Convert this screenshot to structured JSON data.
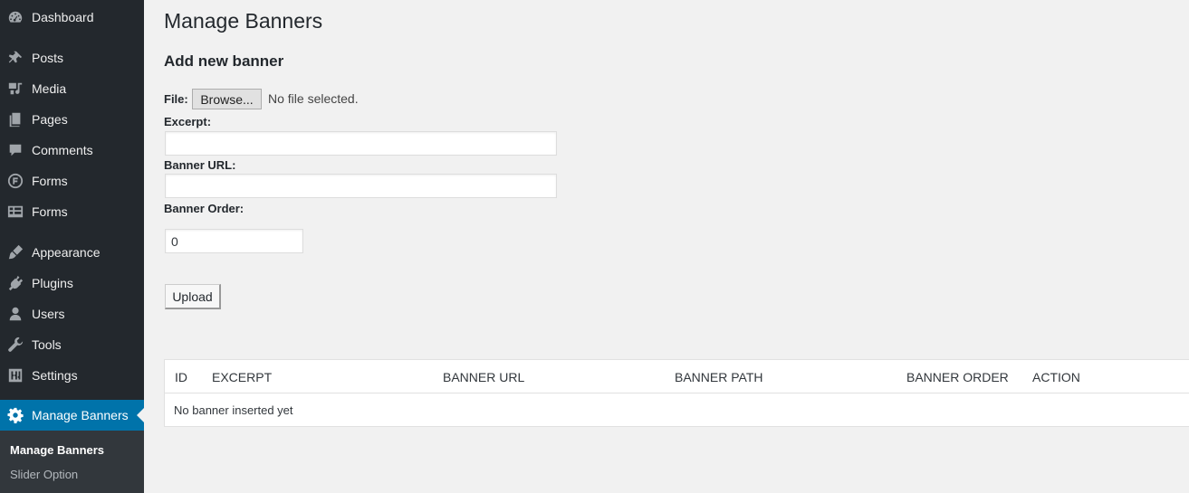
{
  "sidebar": {
    "items": [
      {
        "label": "Dashboard",
        "icon": "dashboard-icon"
      },
      {
        "label": "Posts",
        "icon": "pin-icon"
      },
      {
        "label": "Media",
        "icon": "media-icon"
      },
      {
        "label": "Pages",
        "icon": "pages-icon"
      },
      {
        "label": "Comments",
        "icon": "comment-icon"
      },
      {
        "label": "Forms",
        "icon": "forms-circle-icon"
      },
      {
        "label": "Forms",
        "icon": "forms-list-icon"
      },
      {
        "label": "Appearance",
        "icon": "brush-icon"
      },
      {
        "label": "Plugins",
        "icon": "plug-icon"
      },
      {
        "label": "Users",
        "icon": "user-icon"
      },
      {
        "label": "Tools",
        "icon": "wrench-icon"
      },
      {
        "label": "Settings",
        "icon": "sliders-icon"
      },
      {
        "label": "Manage Banners",
        "icon": "gear-icon"
      }
    ],
    "submenu": [
      "Manage Banners",
      "Slider Option"
    ]
  },
  "page": {
    "title": "Manage Banners",
    "section_title": "Add new banner"
  },
  "form": {
    "file_label": "File:",
    "browse_label": "Browse...",
    "file_status": "No file selected.",
    "excerpt_label": "Excerpt:",
    "excerpt_value": "",
    "url_label": "Banner URL:",
    "url_value": "",
    "order_label": "Banner Order:",
    "order_value": "0",
    "upload_label": "Upload"
  },
  "table": {
    "columns": [
      "ID",
      "EXCERPT",
      "BANNER URL",
      "BANNER PATH",
      "BANNER ORDER",
      "ACTION"
    ],
    "empty_message": "No banner inserted yet"
  },
  "colors": {
    "sidebar_bg": "#23282d",
    "active_bg": "#0073aa",
    "page_bg": "#f1f1f1"
  }
}
